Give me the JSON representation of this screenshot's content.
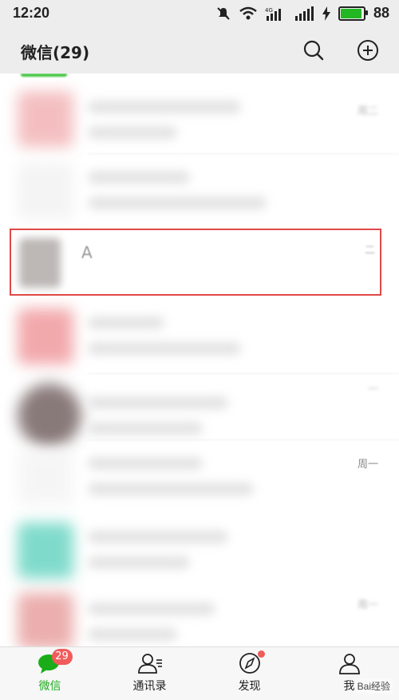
{
  "status_bar": {
    "time": "12:20",
    "battery": "88",
    "battery_level": 0.88,
    "icons": [
      "mute-icon",
      "wifi-icon",
      "signal-4g-icon",
      "signal-icon",
      "charging-icon",
      "battery-icon"
    ]
  },
  "header": {
    "title": "微信(29)",
    "search_icon": "search-icon",
    "add_icon": "add-circle-icon"
  },
  "chats": [
    {
      "time": "周二",
      "avatar_color": "#f3b8ba"
    },
    {
      "time": "",
      "avatar_color": "#f3f3f3"
    },
    {
      "name": "A",
      "time": "二",
      "highlighted": true,
      "avatar_color": "#bdb8b6"
    },
    {
      "time": "",
      "avatar_color": "#f1a0a4"
    },
    {
      "time": "一",
      "avatar_color": "#7d6c6c"
    },
    {
      "time": "周一",
      "avatar_color": "#f5f5f5"
    },
    {
      "time": "",
      "avatar_color": "#72d7c6"
    },
    {
      "time": "周一",
      "avatar_color": "#eaa6a6"
    }
  ],
  "tabs": [
    {
      "label": "微信",
      "icon": "chat-bubble-icon",
      "badge": "29",
      "active": true
    },
    {
      "label": "通讯录",
      "icon": "contacts-icon"
    },
    {
      "label": "发现",
      "icon": "compass-icon",
      "dot": true
    },
    {
      "label": "我",
      "icon": "person-icon"
    }
  ],
  "watermark": "Bai经验",
  "colors": {
    "accent_green": "#1aad19",
    "badge_red": "#f15b5b",
    "highlight_border": "#e04848"
  }
}
